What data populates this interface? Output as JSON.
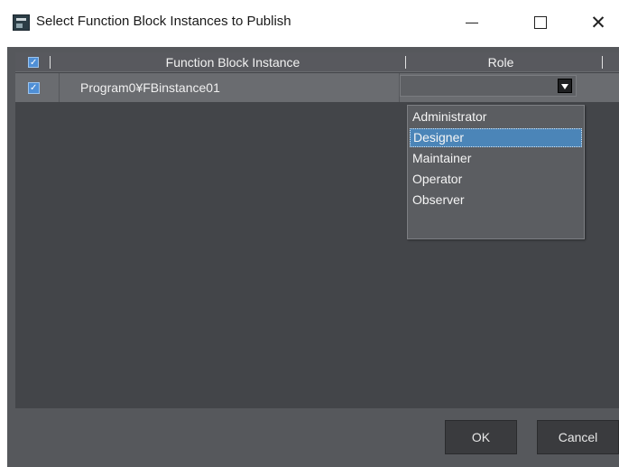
{
  "window": {
    "title": "Select Function Block Instances to Publish",
    "app_icon": "application-icon",
    "controls": {
      "minimize": "minimize-icon",
      "maximize": "maximize-icon",
      "close_glyph": "✕"
    }
  },
  "grid": {
    "header_checkbox_checked": true,
    "columns": [
      "Function Block Instance",
      "Role"
    ],
    "rows": [
      {
        "checked": true,
        "instance": "Program0¥FBinstance01",
        "role": ""
      }
    ]
  },
  "role_dropdown": {
    "open": true,
    "options": [
      "Administrator",
      "Designer",
      "Maintainer",
      "Operator",
      "Observer"
    ],
    "highlighted": "Designer"
  },
  "buttons": {
    "ok": "OK",
    "cancel": "Cancel"
  },
  "colors": {
    "panel_bg": "#56585c",
    "grid_bg": "#434549",
    "row_bg": "#6a6c70",
    "accent_checkbox": "#4f8fd6",
    "selection": "#4b85b8"
  }
}
